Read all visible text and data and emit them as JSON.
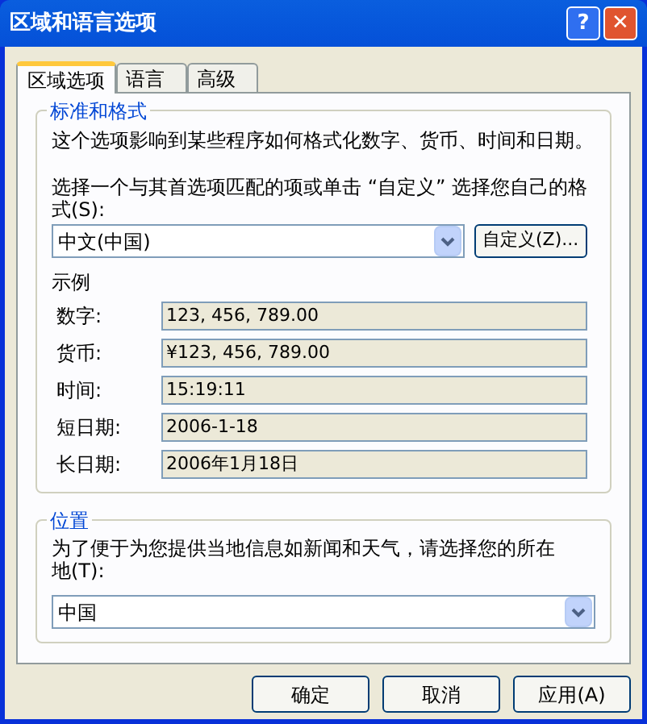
{
  "window": {
    "title": "区域和语言选项"
  },
  "title_buttons": [
    {
      "kind": "help",
      "label": "?"
    },
    {
      "kind": "close",
      "label": "✕"
    }
  ],
  "tabs": [
    {
      "label": "区域选项",
      "selected": true
    },
    {
      "label": "语言",
      "selected": false
    },
    {
      "label": "高级",
      "selected": false
    }
  ],
  "standards": {
    "title": "标准和格式",
    "description": "这个选项影响到某些程序如何格式化数字、货币、时间和日期。",
    "prompt": "选择一个与其首选项匹配的项或单击 “自定义” 选择您自己的格式(S):",
    "format": "中文(中国)",
    "customize_button": "自定义(Z)...",
    "examples_title": "示例",
    "examples": [
      {
        "label": "数字:",
        "value": "123, 456, 789.00"
      },
      {
        "label": "货币:",
        "value": "¥123, 456, 789.00"
      },
      {
        "label": "时间:",
        "value": "15:19:11"
      },
      {
        "label": "短日期:",
        "value": "2006-1-18"
      },
      {
        "label": "长日期:",
        "value": "2006年1月18日"
      }
    ]
  },
  "location": {
    "title": "位置",
    "prompt": "为了便于为您提供当地信息如新闻和天气，请选择您的所在地(T):",
    "value": "中国"
  },
  "buttons": [
    "确定",
    "取消",
    "应用(A)"
  ]
}
